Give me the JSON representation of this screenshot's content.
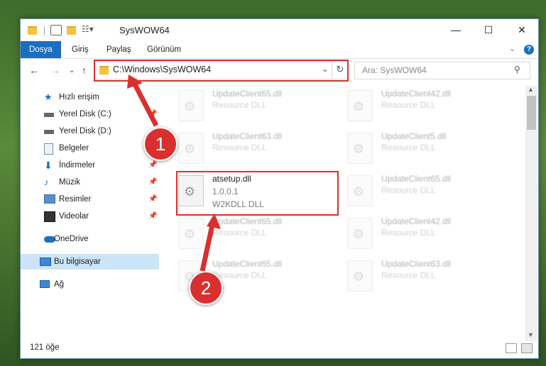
{
  "window": {
    "title": "SysWOW64",
    "controls": {
      "minimize": "—",
      "maximize": "☐",
      "close": "✕"
    }
  },
  "ribbon": {
    "tabs": [
      "Dosya",
      "Giriş",
      "Paylaş",
      "Görünüm"
    ]
  },
  "nav": {
    "address": "C:\\Windows\\SysWOW64",
    "search_placeholder": "Ara: SysWOW64"
  },
  "sidebar": {
    "items": [
      {
        "label": "Hızlı erişim",
        "icon": "star-icon"
      },
      {
        "label": "Yerel Disk (C:)",
        "icon": "drive-icon",
        "pinned": true
      },
      {
        "label": "Yerel Disk (D:)",
        "icon": "drive-icon",
        "pinned": false
      },
      {
        "label": "Belgeler",
        "icon": "document-icon",
        "pinned": true
      },
      {
        "label": "İndirmeler",
        "icon": "download-icon",
        "pinned": true
      },
      {
        "label": "Müzik",
        "icon": "music-icon",
        "pinned": true
      },
      {
        "label": "Resimler",
        "icon": "pictures-icon",
        "pinned": true
      },
      {
        "label": "Videolar",
        "icon": "video-icon",
        "pinned": true
      },
      {
        "label": "OneDrive",
        "icon": "cloud-icon"
      },
      {
        "label": "Bu bilgisayar",
        "icon": "computer-icon"
      },
      {
        "label": "Ağ",
        "icon": "network-icon"
      }
    ]
  },
  "files": [
    {
      "name": "UpdateClient65.dll",
      "type": "Resource DLL"
    },
    {
      "name": "UpdateClient42.dll",
      "type": "Resource DLL"
    },
    {
      "name": "UpdateClient63.dll",
      "type": "Resource DLL"
    },
    {
      "name": "UpdateClient5.dll",
      "type": "Resource DLL"
    },
    {
      "name": "atsetup.dll",
      "version": "1.0.0.1",
      "type": "W2KDLL DLL"
    },
    {
      "name": "UpdateClient65.dll",
      "type": "Resource DLL"
    },
    {
      "name": "UpdateClient65.dll",
      "type": "Resource DLL"
    },
    {
      "name": "UpdateClient42.dll",
      "type": "Resource DLL"
    },
    {
      "name": "UpdateClient65.dll",
      "type": "Resource DLL"
    },
    {
      "name": "UpdateClient63.dll",
      "type": "Resource DLL"
    }
  ],
  "status": {
    "count": "121 öğe"
  },
  "callouts": [
    "1",
    "2"
  ],
  "colors": {
    "accent": "#1a6fc1",
    "highlight": "#d9302f",
    "selected": "#cce4f7"
  }
}
